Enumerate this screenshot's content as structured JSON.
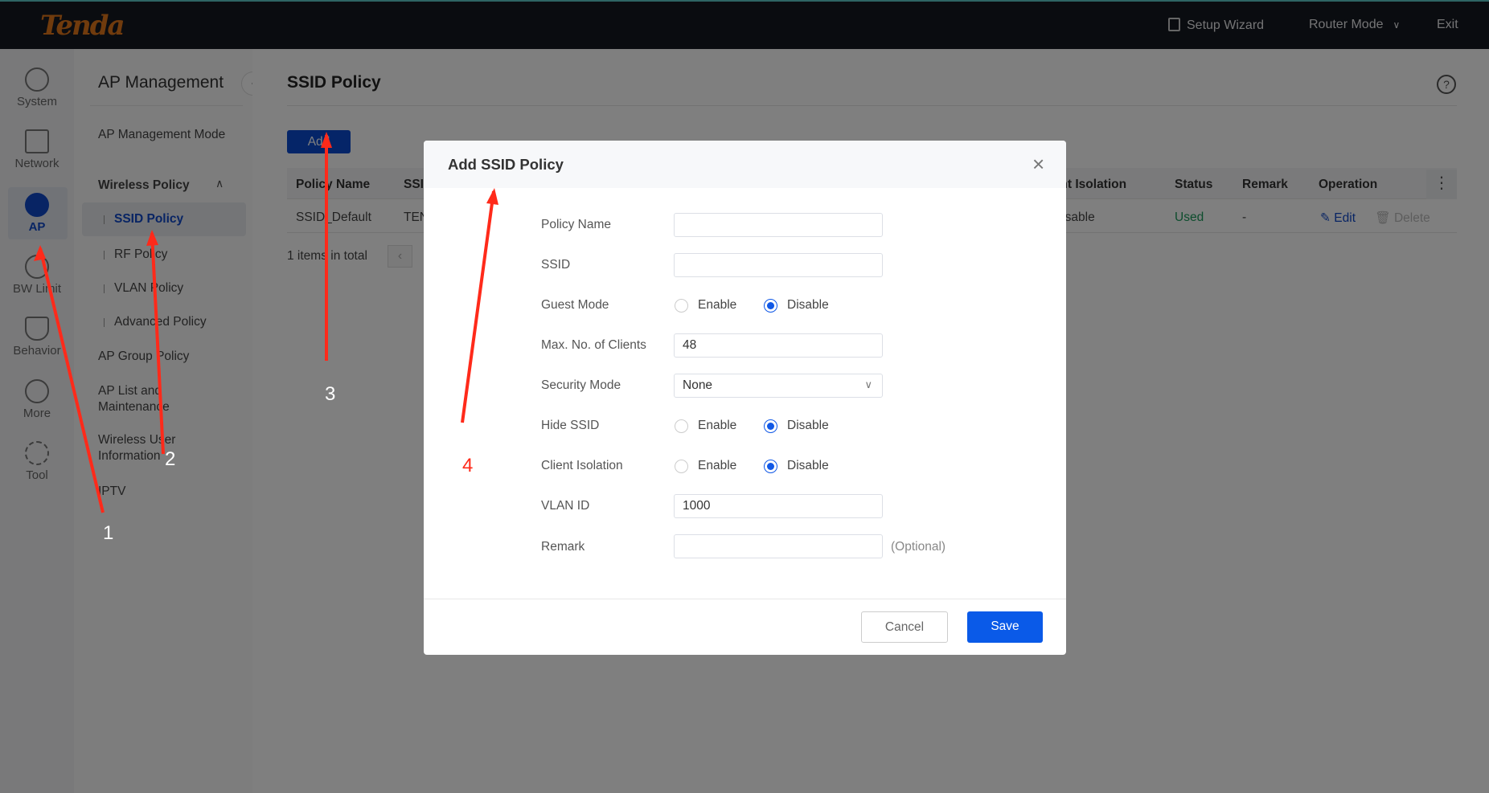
{
  "header": {
    "logo": "Tenda",
    "setup_wizard": "Setup Wizard",
    "router_mode": "Router Mode",
    "exit": "Exit"
  },
  "iconbar": [
    {
      "label": "System",
      "icon": "pie-chart-icon"
    },
    {
      "label": "Network",
      "icon": "network-topology-icon"
    },
    {
      "label": "AP",
      "icon": "ap-icon",
      "active": true
    },
    {
      "label": "BW Limit",
      "icon": "gauge-icon"
    },
    {
      "label": "Behavior",
      "icon": "shield-icon"
    },
    {
      "label": "More",
      "icon": "more-icon"
    },
    {
      "label": "Tool",
      "icon": "gear-icon"
    }
  ],
  "submenu": {
    "title": "AP Management",
    "items": [
      "AP Management Mode",
      "Wireless Policy",
      "SSID Policy",
      "RF Policy",
      "VLAN Policy",
      "Advanced Policy",
      "AP Group Policy",
      "AP List and Maintenance",
      "Wireless User Information",
      "IPTV"
    ],
    "active": "SSID Policy"
  },
  "main": {
    "title": "SSID Policy",
    "add": "Add",
    "table": {
      "headers": [
        "Policy Name",
        "SSID",
        "Client Isolation",
        "Status",
        "Remark",
        "Operation"
      ],
      "rows": [
        {
          "policy_name": "SSID_Default",
          "ssid": "TEN",
          "client_isolation": "Disable",
          "status": "Used",
          "remark": "-",
          "edit": "Edit",
          "delete": "Delete"
        }
      ]
    },
    "total": "1 items in total"
  },
  "modal": {
    "title": "Add SSID Policy",
    "fields": {
      "policy_name": {
        "label": "Policy Name",
        "value": ""
      },
      "ssid": {
        "label": "SSID",
        "value": ""
      },
      "guest_mode": {
        "label": "Guest Mode",
        "value": "Disable"
      },
      "max_clients": {
        "label": "Max. No. of Clients",
        "value": "48"
      },
      "security_mode": {
        "label": "Security Mode",
        "value": "None"
      },
      "hide_ssid": {
        "label": "Hide SSID",
        "value": "Disable"
      },
      "client_isolation": {
        "label": "Client Isolation",
        "value": "Disable"
      },
      "vlan_id": {
        "label": "VLAN ID",
        "value": "1000"
      },
      "remark": {
        "label": "Remark",
        "value": "",
        "hint": "(Optional)"
      }
    },
    "enable": "Enable",
    "disable": "Disable",
    "cancel": "Cancel",
    "save": "Save"
  },
  "annotations": [
    "1",
    "2",
    "3",
    "4"
  ],
  "colors": {
    "accent": "#1058e6",
    "status_used": "#1a9a5a",
    "annotation": "#ff2a1a"
  }
}
